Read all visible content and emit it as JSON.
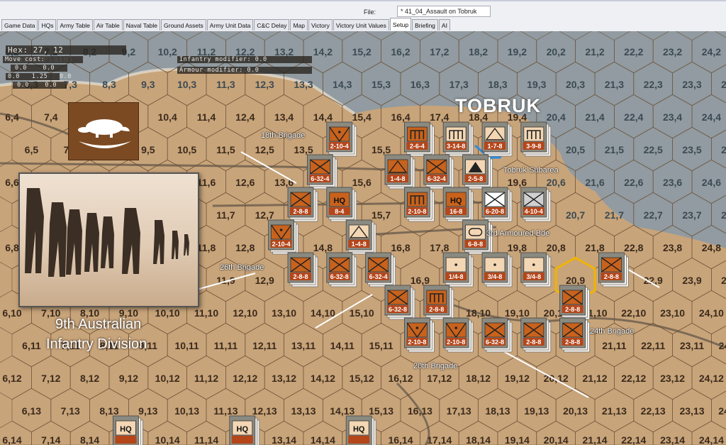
{
  "file": {
    "label": "File:",
    "value": "* 41_04_Assault on Tobruk"
  },
  "tabs": [
    {
      "label": "Game Data"
    },
    {
      "label": "HQs"
    },
    {
      "label": "Army Table"
    },
    {
      "label": "Air Table"
    },
    {
      "label": "Naval Table"
    },
    {
      "label": "Ground Assets"
    },
    {
      "label": "Army Unit Data"
    },
    {
      "label": "C&C Delay"
    },
    {
      "label": "Map"
    },
    {
      "label": "Victory"
    },
    {
      "label": "Victory Unit Values"
    },
    {
      "label": "Setup",
      "active": true
    },
    {
      "label": "Briefing"
    },
    {
      "label": "AI"
    }
  ],
  "hex_info": {
    "title": "Hex: 27, 12 (DesertPlain)",
    "move_cost_label": "Move cost:",
    "row1": "0.0    0.0",
    "row2": "0.0   1.25   0.0",
    "row3": "0.0    0.0",
    "infantry": "Infantry modifier: 0.0",
    "armour": "Armour modifier: 0.0"
  },
  "hex_grid": {
    "cols": [
      6,
      24
    ],
    "rows": [
      2,
      14
    ]
  },
  "map_labels": {
    "tobruk": "TOBRUK",
    "b18": "18th Brigade",
    "b26": "26th Brigade",
    "b20": "20th Brigade",
    "b24": "24th Brigade",
    "subarea": "Tobruk Subarea",
    "armoured": "3rd Armoured Bde",
    "division_line1": "9th Australian",
    "division_line2": "Infantry Division"
  },
  "colors": {
    "orange": "#c8621c",
    "cream": "#f3d6b3",
    "white": "#ffffff",
    "gray": "#d0d0d0",
    "desert": "#c8a47a",
    "sea": "#8e9ba3"
  },
  "units": [
    {
      "hex": [
        14,
        5
      ],
      "label": "2-10-4",
      "fill": "orange",
      "sym": "vdot"
    },
    {
      "hex": [
        16,
        5
      ],
      "label": "2-6-4",
      "fill": "orange",
      "sym": "gun"
    },
    {
      "hex": [
        17,
        5
      ],
      "label": "3-14-8",
      "fill": "cream",
      "sym": "gun"
    },
    {
      "hex": [
        18,
        5
      ],
      "label": "1-7-8",
      "fill": "cream",
      "sym": "tri"
    },
    {
      "hex": [
        19,
        5
      ],
      "label": "3-9-8",
      "fill": "cream",
      "sym": "gun"
    },
    {
      "hex": [
        14,
        6
      ],
      "label": "6-32-4",
      "fill": "orange",
      "sym": "x"
    },
    {
      "hex": [
        16,
        6
      ],
      "label": "1-4-8",
      "fill": "orange",
      "sym": "tri"
    },
    {
      "hex": [
        17,
        6
      ],
      "label": "6-32-4",
      "fill": "orange",
      "sym": "x"
    },
    {
      "hex": [
        18,
        6
      ],
      "label": "2-5-8",
      "fill": "cream",
      "sym": "trifill"
    },
    {
      "hex": [
        13,
        7
      ],
      "label": "2-8-8",
      "fill": "orange",
      "sym": "x"
    },
    {
      "hex": [
        14,
        7
      ],
      "label": "8-4",
      "fill": "orange",
      "sym": "hq"
    },
    {
      "hex": [
        16,
        7
      ],
      "label": "2-10-8",
      "fill": "orange",
      "sym": "gun"
    },
    {
      "hex": [
        17,
        7
      ],
      "label": "16-8",
      "fill": "orange",
      "sym": "hq"
    },
    {
      "hex": [
        18,
        7
      ],
      "label": "6-20-8",
      "fill": "white",
      "sym": "x"
    },
    {
      "hex": [
        19,
        7
      ],
      "label": "4-10-4",
      "fill": "gray",
      "sym": "x"
    },
    {
      "hex": [
        13,
        8
      ],
      "label": "2-10-4",
      "fill": "orange",
      "sym": "vdot"
    },
    {
      "hex": [
        15,
        8
      ],
      "label": "1-4-8",
      "fill": "cream",
      "sym": "tri"
    },
    {
      "hex": [
        18,
        8
      ],
      "label": "6-8-8",
      "fill": "cream",
      "sym": "oval"
    },
    {
      "hex": [
        13,
        9
      ],
      "label": "2-8-8",
      "fill": "orange",
      "sym": "x"
    },
    {
      "hex": [
        14,
        9
      ],
      "label": "6-32-8",
      "fill": "orange",
      "sym": "x"
    },
    {
      "hex": [
        15,
        9
      ],
      "label": "6-32-4",
      "fill": "orange",
      "sym": "x"
    },
    {
      "hex": [
        17,
        9
      ],
      "label": "1/4-8",
      "fill": "cream",
      "sym": "dot"
    },
    {
      "hex": [
        18,
        9
      ],
      "label": "3/4-8",
      "fill": "cream",
      "sym": "dot"
    },
    {
      "hex": [
        19,
        9
      ],
      "label": "3/4-8",
      "fill": "cream",
      "sym": "dot"
    },
    {
      "hex": [
        21,
        9
      ],
      "label": "2-8-8",
      "fill": "orange",
      "sym": "x"
    },
    {
      "hex": [
        16,
        10
      ],
      "label": "6-32-8",
      "fill": "orange",
      "sym": "x"
    },
    {
      "hex": [
        17,
        10
      ],
      "label": "2-8-8",
      "fill": "orange",
      "sym": "gun"
    },
    {
      "hex": [
        20.5,
        10
      ],
      "label": "2-8-8",
      "fill": "orange",
      "sym": "x"
    },
    {
      "hex": [
        16,
        11
      ],
      "label": "2-10-8",
      "fill": "orange",
      "sym": "vdot"
    },
    {
      "hex": [
        17,
        11
      ],
      "label": "2-10-8",
      "fill": "orange",
      "sym": "vdot"
    },
    {
      "hex": [
        18,
        11
      ],
      "label": "6-32-8",
      "fill": "orange",
      "sym": "x"
    },
    {
      "hex": [
        19,
        11
      ],
      "label": "2-8-8",
      "fill": "orange",
      "sym": "x"
    },
    {
      "hex": [
        20,
        11
      ],
      "label": "2-8-8",
      "fill": "orange",
      "sym": "x"
    },
    {
      "hex": [
        9,
        14
      ],
      "label": "HQ",
      "fill": "cream",
      "sym": "hqonly"
    },
    {
      "hex": [
        12,
        14
      ],
      "label": "HQ",
      "fill": "cream",
      "sym": "hqonly"
    },
    {
      "hex": [
        15,
        14
      ],
      "label": "HQ",
      "fill": "cream",
      "sym": "hqonly"
    }
  ]
}
